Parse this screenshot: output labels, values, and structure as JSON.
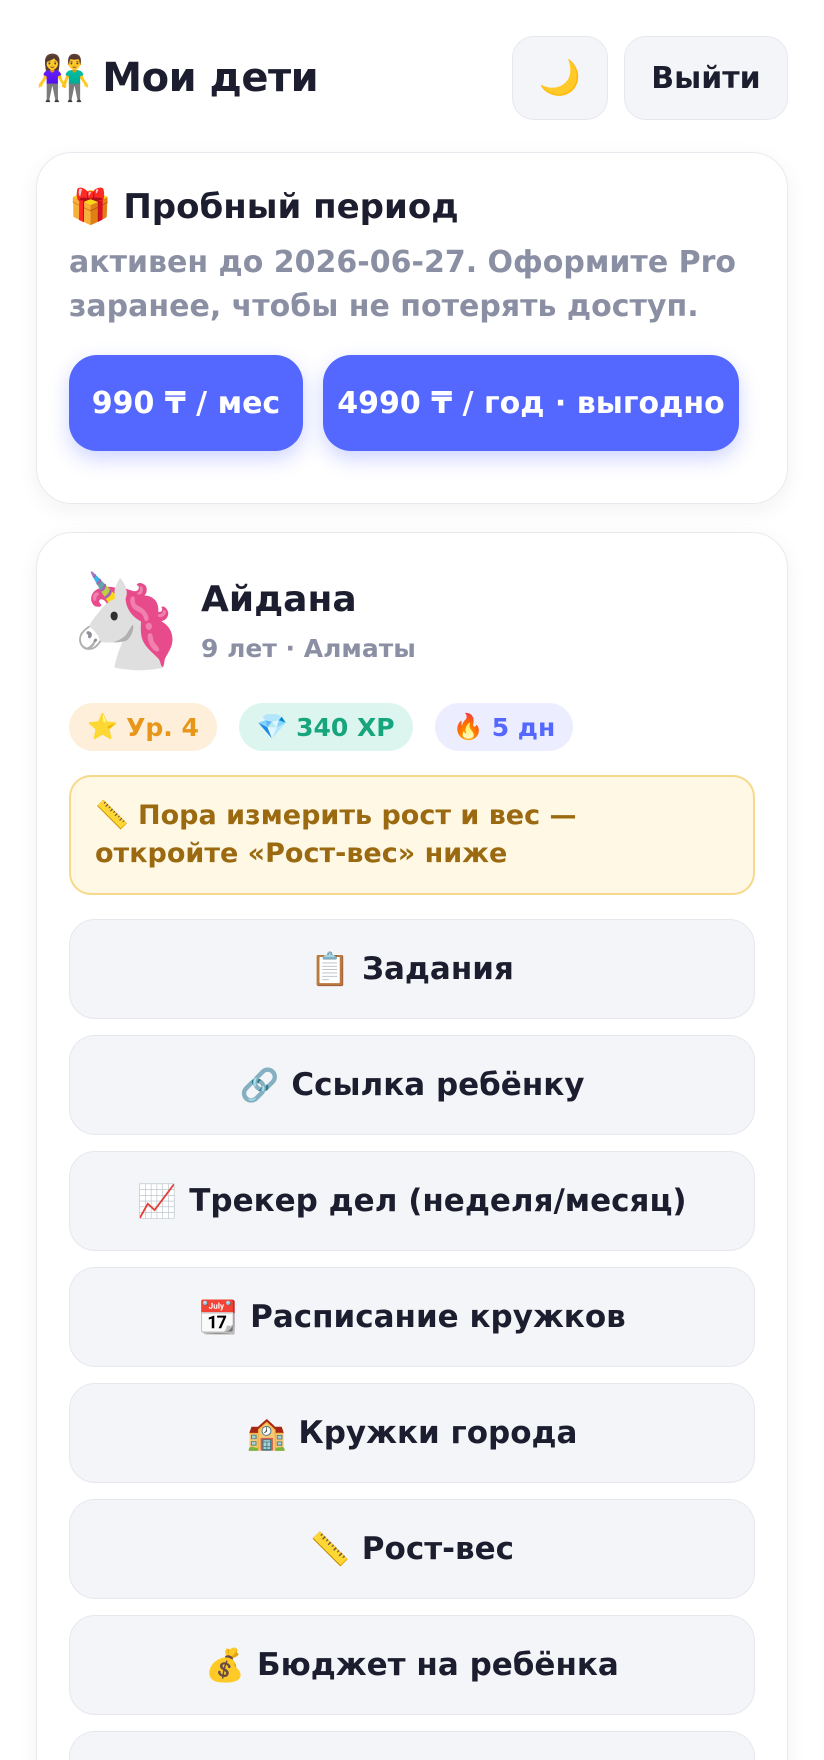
{
  "header": {
    "title_icon": "👫",
    "title_icon_name": "family-icon",
    "title": "Мои дети",
    "theme_icon": "🌙",
    "logout_label": "Выйти"
  },
  "trial": {
    "icon": "🎁",
    "title": "Пробный период",
    "text": "активен до 2026-06-27. Оформите Pro заранее, чтобы не потерять доступ.",
    "monthly_label": "990 ₸ / мес",
    "yearly_label": "4990 ₸ / год · выгодно",
    "accent_color": "#5468ff"
  },
  "child": {
    "avatar": "🦄",
    "name": "Айдана",
    "meta": "9 лет · Алматы",
    "badges": {
      "level_icon": "⭐",
      "level": "Ур. 4",
      "xp_icon": "💎",
      "xp": "340 XP",
      "streak_icon": "🔥",
      "streak": "5 дн"
    },
    "alert": "📏 Пора измерить рост и вес — откройте «Рост-вес» ниже",
    "actions": [
      {
        "icon": "📋",
        "label": "Задания"
      },
      {
        "icon": "🔗",
        "label": "Ссылка ребёнку"
      },
      {
        "icon": "📈",
        "label": "Трекер дел (неделя/месяц)"
      },
      {
        "icon": "📆",
        "label": "Расписание кружков"
      },
      {
        "icon": "🏫",
        "label": "Кружки города"
      },
      {
        "icon": "📏",
        "label": "Рост-вес"
      },
      {
        "icon": "💰",
        "label": "Бюджет на ребёнка"
      }
    ]
  }
}
